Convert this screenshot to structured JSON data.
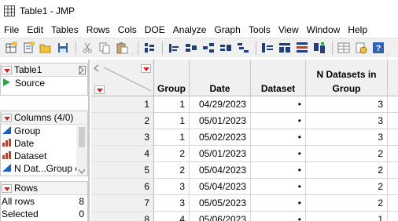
{
  "window": {
    "title": "Table1 - JMP"
  },
  "menu": [
    "File",
    "Edit",
    "Tables",
    "Rows",
    "Cols",
    "DOE",
    "Analyze",
    "Graph",
    "Tools",
    "View",
    "Window",
    "Help"
  ],
  "toolbar": {
    "icons": [
      "new-data-table-icon",
      "new-script-icon",
      "open-icon",
      "save-icon",
      "cut-icon",
      "copy-icon",
      "paste-icon",
      "layout-icon",
      "distribution-icon",
      "fit-y-by-x-icon",
      "fit-model-icon",
      "graph-builder-icon",
      "control-chart-icon",
      "table-summary-icon",
      "tabulate-icon",
      "join-icon",
      "stack-icon",
      "split-icon",
      "script-icon",
      "help-icon"
    ],
    "more": "˯"
  },
  "left": {
    "table_panel": {
      "title": "Table1",
      "source_label": "Source"
    },
    "columns_panel": {
      "title": "Columns (4/0)",
      "items": [
        {
          "label": "Group",
          "icon": "continuous-icon"
        },
        {
          "label": "Date",
          "icon": "ordinal-icon"
        },
        {
          "label": "Dataset",
          "icon": "ordinal-icon"
        },
        {
          "label": "N Dat...Group é",
          "icon": "continuous-icon"
        }
      ]
    },
    "rows_panel": {
      "title": "Rows",
      "items": [
        {
          "label": "All rows",
          "value": "8"
        },
        {
          "label": "Selected",
          "value": "0"
        }
      ]
    }
  },
  "table": {
    "columns": [
      "Group",
      "Date",
      "Dataset",
      "N Datasets in Group"
    ],
    "rows": [
      {
        "n": "1",
        "group": "1",
        "date": "04/29/2023",
        "dataset": "•",
        "ndatasets": "3"
      },
      {
        "n": "2",
        "group": "1",
        "date": "05/01/2023",
        "dataset": "•",
        "ndatasets": "3"
      },
      {
        "n": "3",
        "group": "1",
        "date": "05/02/2023",
        "dataset": "•",
        "ndatasets": "3"
      },
      {
        "n": "4",
        "group": "2",
        "date": "05/01/2023",
        "dataset": "•",
        "ndatasets": "2"
      },
      {
        "n": "5",
        "group": "2",
        "date": "05/04/2023",
        "dataset": "•",
        "ndatasets": "2"
      },
      {
        "n": "6",
        "group": "3",
        "date": "05/04/2023",
        "dataset": "•",
        "ndatasets": "2"
      },
      {
        "n": "7",
        "group": "3",
        "date": "05/05/2023",
        "dataset": "•",
        "ndatasets": "2"
      },
      {
        "n": "8",
        "group": "4",
        "date": "05/06/2023",
        "dataset": "•",
        "ndatasets": "1"
      }
    ]
  },
  "colors": {
    "red_triangle": "#d81e1e",
    "header_bg": "#f0f0f0",
    "continuous_blue": "#1f5fbf",
    "ordinal_red": "#d33a1c",
    "source_green": "#2fa34a"
  }
}
